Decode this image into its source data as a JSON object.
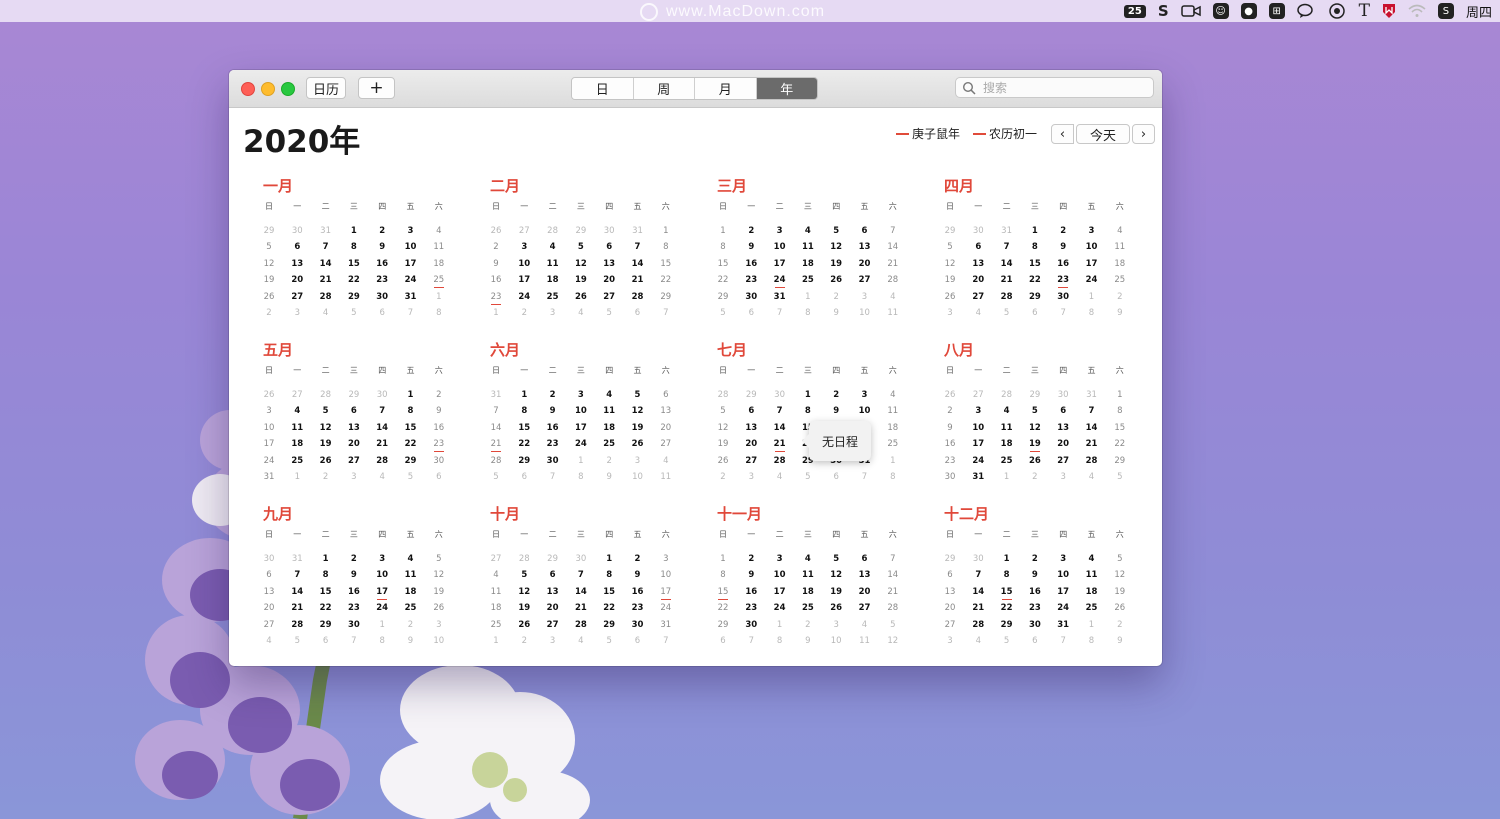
{
  "watermark": "www.MacDown.com",
  "menubar": {
    "badge": "25",
    "day_of_week": "周四",
    "icons": [
      "s-icon",
      "camera-icon",
      "face-icon",
      "mic-icon",
      "grid-icon",
      "chat-icon",
      "cloud-icon",
      "type-t-icon",
      "shield-icon",
      "wifi-icon",
      "sogou-icon"
    ]
  },
  "toolbar": {
    "calendars_label": "日历",
    "add_label": "+",
    "segments": [
      "日",
      "周",
      "月",
      "年"
    ],
    "active_segment": "年",
    "search_placeholder": "搜索"
  },
  "header": {
    "year_title": "2020年",
    "legend_zodiac": "庚子鼠年",
    "legend_lunar": "农历初一",
    "today_label": "今天",
    "prev_label": "‹",
    "next_label": "›"
  },
  "weekday_headers": [
    "日",
    "一",
    "二",
    "三",
    "四",
    "五",
    "六"
  ],
  "months": [
    {
      "name": "一月",
      "start": 3,
      "len": 31,
      "prev_len": 31,
      "holidays": [
        25
      ]
    },
    {
      "name": "二月",
      "start": 6,
      "len": 29,
      "prev_len": 31,
      "holidays": [
        23
      ]
    },
    {
      "name": "三月",
      "start": 0,
      "len": 31,
      "prev_len": 29,
      "holidays": [
        24
      ]
    },
    {
      "name": "四月",
      "start": 3,
      "len": 30,
      "prev_len": 31,
      "holidays": [
        23
      ]
    },
    {
      "name": "五月",
      "start": 5,
      "len": 31,
      "prev_len": 30,
      "holidays": [
        23
      ]
    },
    {
      "name": "六月",
      "start": 1,
      "len": 30,
      "prev_len": 31,
      "holidays": [
        21
      ]
    },
    {
      "name": "七月",
      "start": 3,
      "len": 31,
      "prev_len": 30,
      "holidays": [
        21
      ]
    },
    {
      "name": "八月",
      "start": 6,
      "len": 31,
      "prev_len": 31,
      "holidays": [
        19
      ]
    },
    {
      "name": "九月",
      "start": 2,
      "len": 30,
      "prev_len": 31,
      "holidays": [
        17
      ]
    },
    {
      "name": "十月",
      "start": 4,
      "len": 31,
      "prev_len": 30,
      "holidays": [
        17
      ]
    },
    {
      "name": "十一月",
      "start": 0,
      "len": 30,
      "prev_len": 31,
      "holidays": [
        15
      ]
    },
    {
      "name": "十二月",
      "start": 2,
      "len": 31,
      "prev_len": 30,
      "holidays": [
        15
      ]
    }
  ],
  "tooltip": "无日程",
  "colors": {
    "accent": "#e0483a",
    "active_segment": "#6b6b6b"
  }
}
